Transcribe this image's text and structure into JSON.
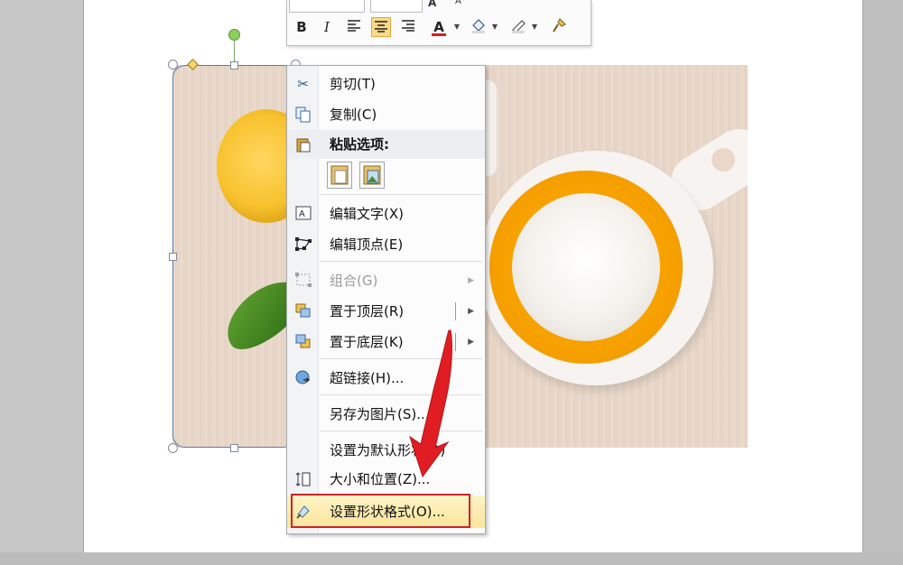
{
  "mini_toolbar": {
    "bold": "B",
    "italic": "I",
    "font_color_letter": "A",
    "grow_font": "A",
    "colors": {
      "font_color_bar": "#d3202a",
      "active_bg": "#fbd98a"
    }
  },
  "context_menu": {
    "items": [
      {
        "label": "剪切(T)",
        "icon": "scissors-icon"
      },
      {
        "label": "复制(C)",
        "icon": "copy-icon"
      },
      {
        "label": "粘贴选项:",
        "icon": "paste-icon"
      },
      {
        "label": "编辑文字(X)",
        "icon": "edit-text-icon"
      },
      {
        "label": "编辑顶点(E)",
        "icon": "edit-points-icon"
      },
      {
        "label": "组合(G)",
        "icon": "group-icon",
        "disabled": true
      },
      {
        "label": "置于顶层(R)",
        "icon": "bring-to-front-icon"
      },
      {
        "label": "置于底层(K)",
        "icon": "send-to-back-icon"
      },
      {
        "label": "超链接(H)...",
        "icon": "hyperlink-icon"
      },
      {
        "label": "另存为图片(S)...",
        "icon": ""
      },
      {
        "label": "设置为默认形状(D)",
        "icon": ""
      },
      {
        "label": "大小和位置(Z)...",
        "icon": "size-position-icon"
      },
      {
        "label": "设置形状格式(O)...",
        "icon": "format-shape-icon"
      }
    ],
    "paste_options": [
      "paste-keep-text-icon",
      "paste-picture-icon"
    ]
  },
  "colors": {
    "highlight_border": "#d3202a",
    "selection_border": "#5b79a8",
    "rotation_handle": "#8bd05a"
  }
}
